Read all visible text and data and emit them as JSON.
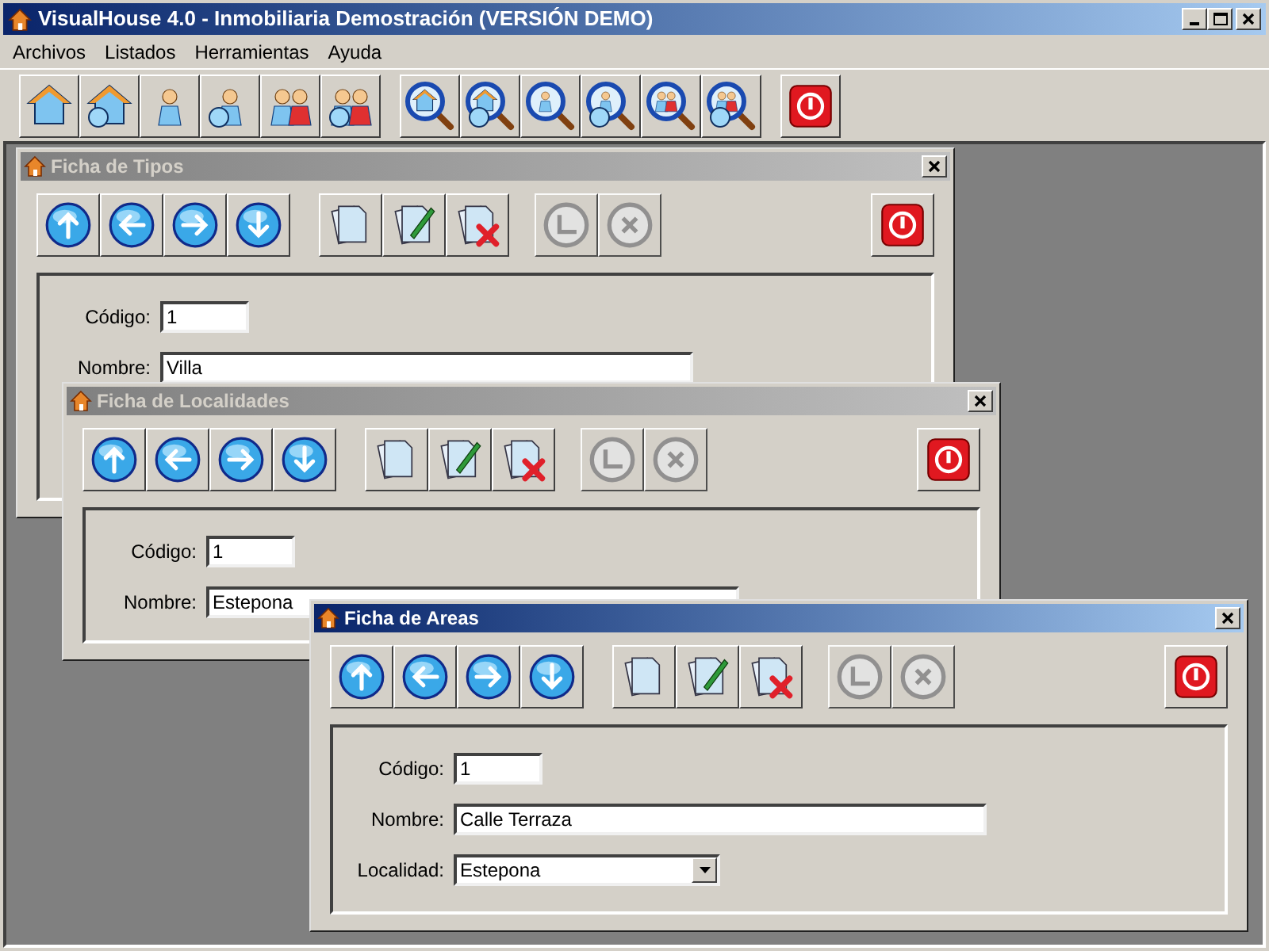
{
  "app": {
    "title": "VisualHouse 4.0 - Inmobiliaria Demostración (VERSIÓN DEMO)"
  },
  "menu": [
    "Archivos",
    "Listados",
    "Herramientas",
    "Ayuda"
  ],
  "windows": [
    {
      "title": "Ficha de Tipos",
      "active": false,
      "tools": [
        {
          "kind": "up",
          "disabled": false
        },
        {
          "kind": "left",
          "disabled": false
        },
        {
          "kind": "right",
          "disabled": false
        },
        {
          "kind": "down",
          "disabled": false
        },
        {
          "kind": "new",
          "disabled": false
        },
        {
          "kind": "edit",
          "disabled": false
        },
        {
          "kind": "delete",
          "disabled": false
        },
        {
          "kind": "confirm",
          "disabled": true
        },
        {
          "kind": "cancel",
          "disabled": true
        },
        {
          "kind": "exit",
          "disabled": false
        }
      ],
      "fields": [
        {
          "kind": "code",
          "label": "Código:",
          "value": "1"
        },
        {
          "kind": "text",
          "label": "Nombre:",
          "value": "Villa"
        }
      ]
    },
    {
      "title": "Ficha de Localidades",
      "active": false,
      "tools": [
        {
          "kind": "up",
          "disabled": false
        },
        {
          "kind": "left",
          "disabled": false
        },
        {
          "kind": "right",
          "disabled": false
        },
        {
          "kind": "down",
          "disabled": false
        },
        {
          "kind": "new",
          "disabled": false
        },
        {
          "kind": "edit",
          "disabled": false
        },
        {
          "kind": "delete",
          "disabled": false
        },
        {
          "kind": "confirm",
          "disabled": true
        },
        {
          "kind": "cancel",
          "disabled": true
        },
        {
          "kind": "exit",
          "disabled": false
        }
      ],
      "fields": [
        {
          "kind": "code",
          "label": "Código:",
          "value": "1"
        },
        {
          "kind": "text",
          "label": "Nombre:",
          "value": "Estepona"
        }
      ]
    },
    {
      "title": "Ficha de Areas",
      "active": true,
      "tools": [
        {
          "kind": "up",
          "disabled": false
        },
        {
          "kind": "left",
          "disabled": false
        },
        {
          "kind": "right",
          "disabled": false
        },
        {
          "kind": "down",
          "disabled": false
        },
        {
          "kind": "new",
          "disabled": false
        },
        {
          "kind": "edit",
          "disabled": false
        },
        {
          "kind": "delete",
          "disabled": false
        },
        {
          "kind": "confirm",
          "disabled": true
        },
        {
          "kind": "cancel",
          "disabled": true
        },
        {
          "kind": "exit",
          "disabled": false
        }
      ],
      "fields": [
        {
          "kind": "code",
          "label": "Código:",
          "value": "1"
        },
        {
          "kind": "text",
          "label": "Nombre:",
          "value": "Calle Terraza"
        },
        {
          "kind": "select",
          "label": "Localidad:",
          "value": "Estepona"
        }
      ]
    }
  ]
}
